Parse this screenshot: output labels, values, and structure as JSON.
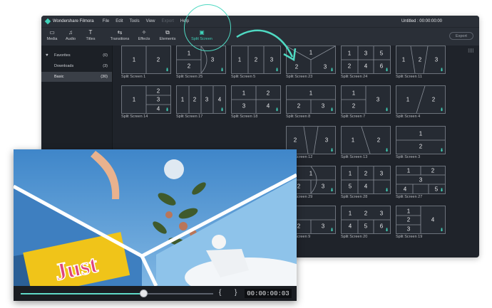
{
  "app": {
    "brand": "Wondershare Filmora",
    "menu": [
      "File",
      "Edit",
      "Tools",
      "View",
      "Export",
      "Help"
    ],
    "title": "Untitled : 00:00:00:00",
    "export_label": "Export"
  },
  "toolbar": [
    {
      "label": "Media",
      "icon": "folder-icon",
      "glyph": "▭"
    },
    {
      "label": "Audio",
      "icon": "music-note-icon",
      "glyph": "♫"
    },
    {
      "label": "Titles",
      "icon": "text-t-icon",
      "glyph": "T"
    },
    {
      "label": "Transitions",
      "icon": "transition-icon",
      "glyph": "⇆"
    },
    {
      "label": "Effects",
      "icon": "effects-icon",
      "glyph": "✧"
    },
    {
      "label": "Elements",
      "icon": "elements-icon",
      "glyph": "⧉"
    },
    {
      "label": "Split Screen",
      "icon": "split-screen-icon",
      "glyph": "▣"
    }
  ],
  "sidebar": [
    {
      "label": "Favorites",
      "count": "(0)"
    },
    {
      "label": "Downloads",
      "count": "(3)"
    },
    {
      "label": "Basic",
      "count": "(30)"
    }
  ],
  "tiles": [
    {
      "caption": "Split Screen 1",
      "numbers": [
        "1",
        "2"
      ]
    },
    {
      "caption": "Split Screen 25",
      "numbers": [
        "1",
        "2",
        "3"
      ]
    },
    {
      "caption": "Split Screen 5",
      "numbers": [
        "1",
        "2",
        "3"
      ]
    },
    {
      "caption": "Split Screen 23",
      "numbers": [
        "1",
        "2",
        "3"
      ]
    },
    {
      "caption": "Split Screen 24",
      "numbers": [
        "1",
        "3",
        "5",
        "2",
        "4",
        "6"
      ]
    },
    {
      "caption": "Split Screen 11",
      "numbers": [
        "1",
        "2",
        "3"
      ]
    },
    {
      "caption": "Split Screen 14",
      "numbers": [
        "1",
        "2",
        "3",
        "4"
      ]
    },
    {
      "caption": "Split Screen 17",
      "numbers": [
        "1",
        "2",
        "3",
        "4"
      ]
    },
    {
      "caption": "Split Screen 18",
      "numbers": [
        "1",
        "2",
        "3",
        "4"
      ]
    },
    {
      "caption": "Split Screen 8",
      "numbers": [
        "1",
        "2",
        "3"
      ]
    },
    {
      "caption": "Split Screen 7",
      "numbers": [
        "1",
        "2",
        "3"
      ]
    },
    {
      "caption": "Split Screen 4",
      "numbers": [
        "1",
        "2"
      ]
    },
    {
      "caption": "Split Screen 12",
      "numbers": [
        "2",
        "3"
      ]
    },
    {
      "caption": "Split Screen 13",
      "numbers": [
        "1",
        "2"
      ]
    },
    {
      "caption": "Split Screen 3",
      "numbers": [
        "1",
        "2"
      ]
    },
    {
      "caption": "Split Screen 29",
      "numbers": [
        "1",
        "2",
        "3"
      ]
    },
    {
      "caption": "Split Screen 28",
      "numbers": [
        "1",
        "2",
        "3",
        "4",
        "5"
      ]
    },
    {
      "caption": "Split Screen 27",
      "numbers": [
        "1",
        "2",
        "3",
        "4",
        "5"
      ]
    },
    {
      "caption": "Split Screen 9",
      "numbers": [
        "2",
        "3"
      ]
    },
    {
      "caption": "Split Screen 20",
      "numbers": [
        "1",
        "2",
        "3",
        "4",
        "5",
        "6"
      ]
    },
    {
      "caption": "Split Screen 19",
      "numbers": [
        "1",
        "2",
        "3",
        "4"
      ]
    }
  ],
  "preview": {
    "timecode": "00:00:00:03",
    "progress": 0.64,
    "sign_text": "Just",
    "brace_left": "{",
    "brace_right": "}"
  },
  "colors": {
    "accent": "#3fd1b8",
    "panel": "#1f232a",
    "toolbar": "#2a2f37"
  }
}
